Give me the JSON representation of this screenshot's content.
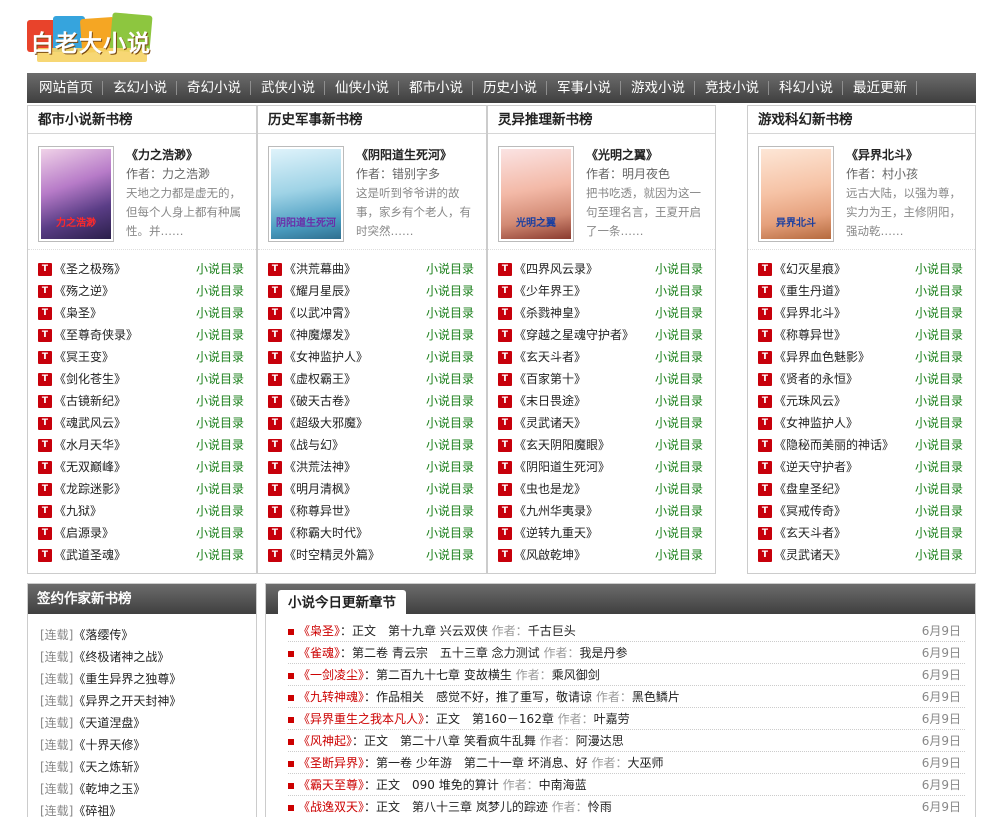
{
  "logo": {
    "text": "白老大小说"
  },
  "nav": [
    "网站首页",
    "玄幻小说",
    "奇幻小说",
    "武侠小说",
    "仙侠小说",
    "都市小说",
    "历史小说",
    "军事小说",
    "游戏小说",
    "竞技小说",
    "科幻小说",
    "最近更新"
  ],
  "panels": [
    {
      "title": "都市小说新书榜",
      "featured": {
        "title": "《力之浩渺》",
        "author": "作者：力之浩渺",
        "desc": "天地之力都是虚无的，但每个人身上都有种属性。并……",
        "cover_caption": "力之浩渺"
      },
      "list": [
        "《圣之极殇》",
        "《殇之逆》",
        "《枭圣》",
        "《至尊奇侠录》",
        "《冥王变》",
        "《剑化苍生》",
        "《古镜新纪》",
        "《魂武风云》",
        "《水月天华》",
        "《无双巅峰》",
        "《龙踪迷影》",
        "《九狱》",
        "《启源录》",
        "《武道圣魂》"
      ]
    },
    {
      "title": "历史军事新书榜",
      "featured": {
        "title": "《阴阳道生死河》",
        "author": "作者：错别字多",
        "desc": "这是听到爷爷讲的故事，家乡有个老人，有时突然……",
        "cover_caption": "阴阳道生死河"
      },
      "list": [
        "《洪荒幕曲》",
        "《耀月星辰》",
        "《以武冲霄》",
        "《神魔爆发》",
        "《女神监护人》",
        "《虚权霸王》",
        "《破天古卷》",
        "《超级大邪魔》",
        "《战与幻》",
        "《洪荒法神》",
        "《明月清枫》",
        "《称尊异世》",
        "《称霸大时代》",
        "《时空精灵外篇》"
      ]
    },
    {
      "title": "灵异推理新书榜",
      "featured": {
        "title": "《光明之翼》",
        "author": "作者：明月夜色",
        "desc": "把书吃透，就因为这一句至理名言，王夏开启了一条……",
        "cover_caption": "光明之翼"
      },
      "list": [
        "《四界风云录》",
        "《少年界王》",
        "《杀戮神皇》",
        "《穿越之星魂守护者》",
        "《玄天斗者》",
        "《百家第十》",
        "《末日畏途》",
        "《灵武诸天》",
        "《玄天阴阳魔眼》",
        "《阴阳道生死河》",
        "《虫也是龙》",
        "《九州华夷录》",
        "《逆转九重天》",
        "《风啟乾坤》"
      ]
    },
    {
      "title": "游戏科幻新书榜",
      "featured": {
        "title": "《异界北斗》",
        "author": "作者：村小孩",
        "desc": "远古大陆，以强为尊，实力为王，主修阴阳，强动乾……",
        "cover_caption": "异界北斗"
      },
      "list": [
        "《幻灭星痕》",
        "《重生丹道》",
        "《异界北斗》",
        "《称尊异世》",
        "《异界血色魅影》",
        "《贤者的永恒》",
        "《元珠风云》",
        "《女神监护人》",
        "《隐秘而美丽的神话》",
        "《逆天守护者》",
        "《盘皇圣纪》",
        "《冥戒传奇》",
        "《玄天斗者》",
        "《灵武诸天》"
      ]
    }
  ],
  "list_category": "小说目录",
  "signed": {
    "title": "签约作家新书榜",
    "tag": "[连载]",
    "books": [
      "《落缨传》",
      "《终极诸神之战》",
      "《重生异界之独尊》",
      "《异界之开天封神》",
      "《天道涅盘》",
      "《十界天修》",
      "《天之炼斩》",
      "《乾坤之玉》",
      "《碎祖》"
    ]
  },
  "updates": {
    "tab": "小说今日更新章节",
    "author_label": "作者：",
    "rows": [
      {
        "book": "《枭圣》",
        "chapter": "：正文　第十九章 兴云双侠",
        "author": "千古巨头",
        "date": "6月9日"
      },
      {
        "book": "《雀魂》",
        "chapter": "：第二卷 青云宗　五十三章 念力测试",
        "author": "我是丹参",
        "date": "6月9日"
      },
      {
        "book": "《一剑凌尘》",
        "chapter": "：第二百九十七章 变故横生",
        "author": "乘风御剑",
        "date": "6月9日"
      },
      {
        "book": "《九转神魂》",
        "chapter": "：作品相关　感觉不好，推了重写，敬请谅",
        "author": "黑色鳞片",
        "date": "6月9日"
      },
      {
        "book": "《异界重生之我本凡人》",
        "chapter": "：正文　第160－162章",
        "author": "叶嘉劳",
        "date": "6月9日"
      },
      {
        "book": "《风神起》",
        "chapter": "：正文　第二十八章 笑看疯牛乱舞",
        "author": "阿漫达思",
        "date": "6月9日"
      },
      {
        "book": "《圣断异界》",
        "chapter": "：第一卷 少年游　第二十一章 坏消息、好",
        "author": "大巫师",
        "date": "6月9日"
      },
      {
        "book": "《霸天至尊》",
        "chapter": "：正文　090 堆免的算计",
        "author": "中南海蓝",
        "date": "6月9日"
      },
      {
        "book": "《战逸双天》",
        "chapter": "：正文　第八十三章 岚梦儿的踪迹",
        "author": "怜雨",
        "date": "6月9日"
      }
    ]
  },
  "colors": {
    "nav_bg": "#4a4a4a",
    "accent_red": "#c7000b",
    "link_green": "#1a7f1a"
  }
}
